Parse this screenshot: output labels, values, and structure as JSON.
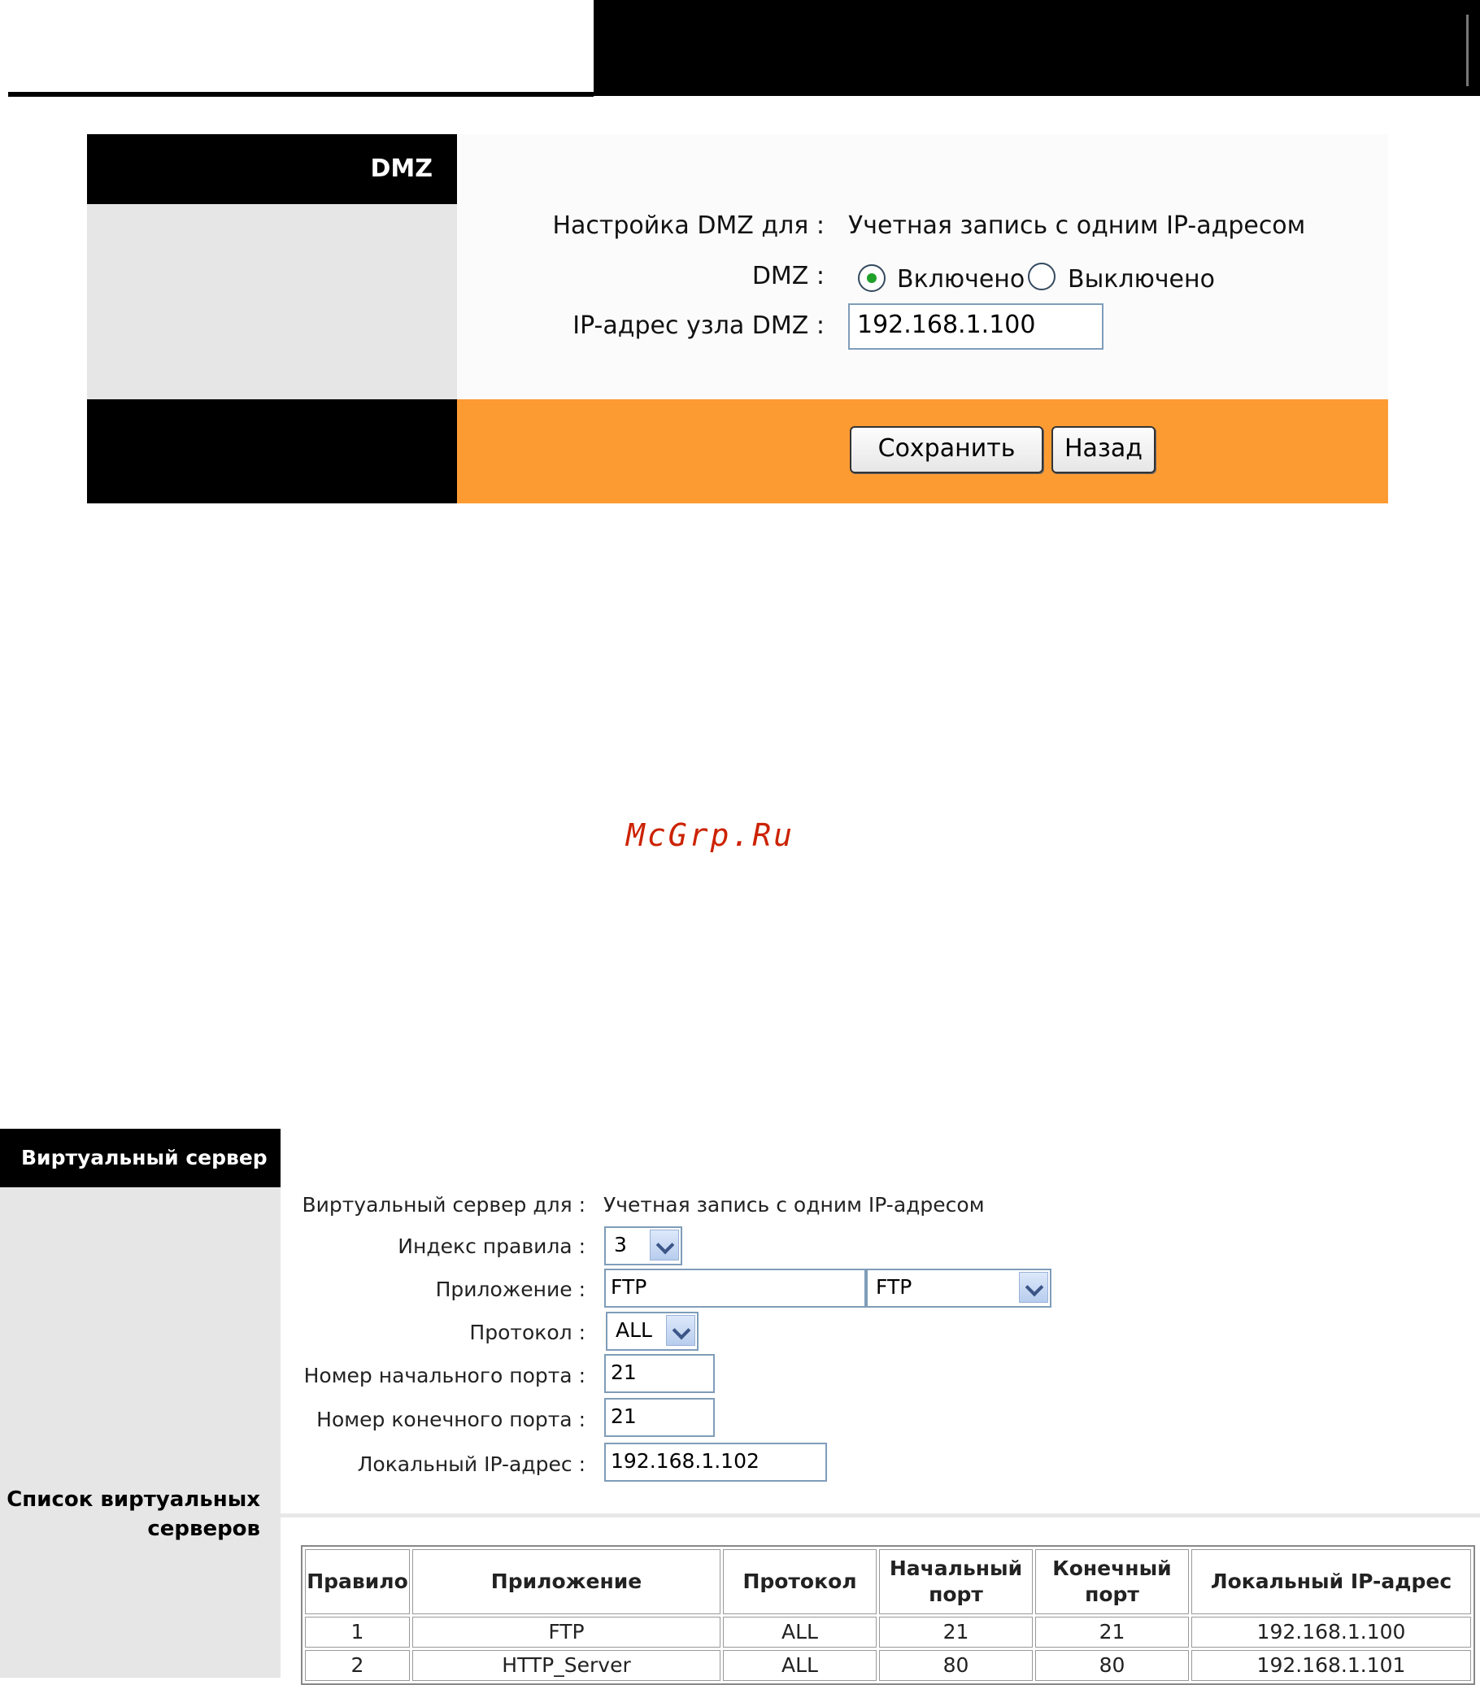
{
  "dmz": {
    "title": "DMZ",
    "config_label": "Настройка DMZ для :",
    "config_value": "Учетная запись с одним IP-адресом",
    "dmz_label": "DMZ :",
    "radio_on_label": "Включено",
    "radio_off_label": "Выключено",
    "selected": "Включено",
    "host_ip_label": "IP-адрес узла DMZ :",
    "host_ip_value": "192.168.1.100",
    "save_button": "Сохранить",
    "back_button": "Назад"
  },
  "watermark": "McGrp.Ru",
  "virtual_server": {
    "title": "Виртуальный сервер",
    "config_label": "Виртуальный сервер для :",
    "config_value": "Учетная запись с одним IP-адресом",
    "rule_index_label": "Индекс правила :",
    "rule_index_value": "3",
    "application_label": "Приложение :",
    "application_input": "FTP",
    "application_select": "FTP",
    "protocol_label": "Протокол :",
    "protocol_value": "ALL",
    "start_port_label": "Номер начального порта :",
    "start_port_value": "21",
    "end_port_label": "Номер конечного порта :",
    "end_port_value": "21",
    "local_ip_label": "Локальный IP-адрес :",
    "local_ip_value": "192.168.1.102",
    "list_label_line1": "Список виртуальных",
    "list_label_line2": "серверов",
    "table": {
      "headers": [
        "Правило",
        "Приложение",
        "Протокол",
        "Начальный порт",
        "Конечный порт",
        "Локальный IP-адрес"
      ],
      "rows": [
        [
          "1",
          "FTP",
          "ALL",
          "21",
          "21",
          "192.168.1.100"
        ],
        [
          "2",
          "HTTP_Server",
          "ALL",
          "80",
          "80",
          "192.168.1.101"
        ]
      ]
    }
  }
}
